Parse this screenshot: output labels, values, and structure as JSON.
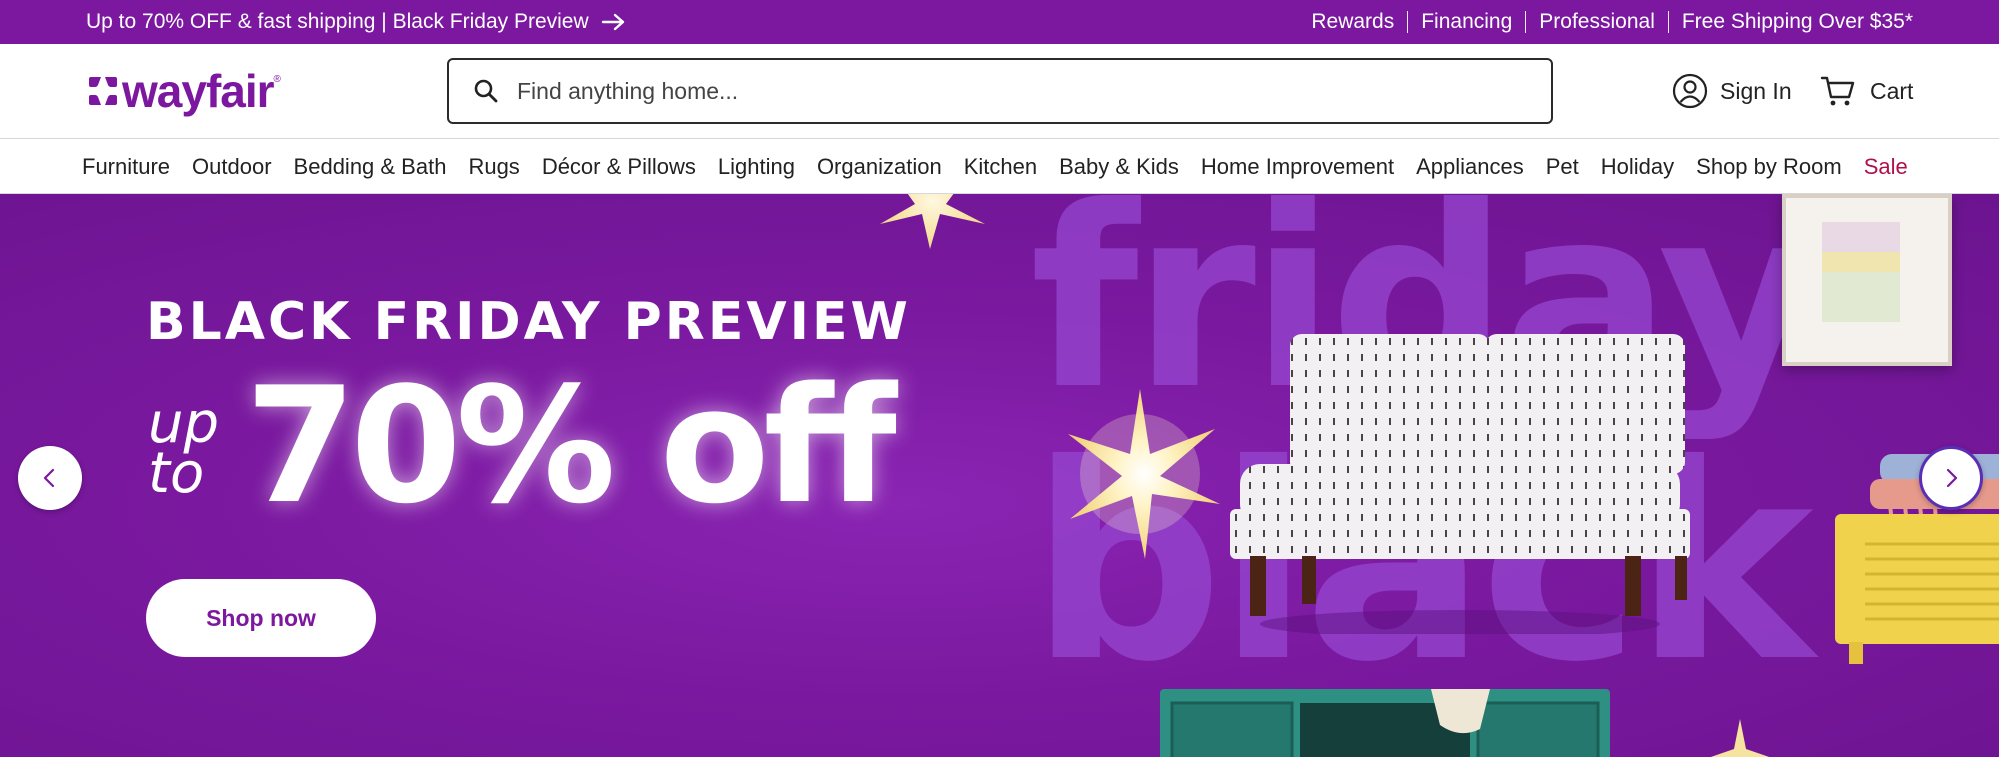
{
  "topbar": {
    "promo": "Up to 70% OFF & fast shipping | Black Friday Preview",
    "links": [
      "Rewards",
      "Financing",
      "Professional",
      "Free Shipping Over $35*"
    ]
  },
  "header": {
    "logo": "wayfair",
    "search_placeholder": "Find anything home...",
    "sign_in": "Sign In",
    "cart": "Cart"
  },
  "categories": [
    "Furniture",
    "Outdoor",
    "Bedding & Bath",
    "Rugs",
    "Décor & Pillows",
    "Lighting",
    "Organization",
    "Kitchen",
    "Baby & Kids",
    "Home Improvement",
    "Appliances",
    "Pet",
    "Holiday",
    "Shop by Room",
    "Sale"
  ],
  "hero": {
    "eyebrow": "BLACK FRIDAY PREVIEW",
    "up": "up",
    "to": "to",
    "big": "70% off",
    "cta": "Shop now",
    "bg_word_1": "friday",
    "bg_word_2": "black",
    "slides_total": 4,
    "slide_active": 1
  },
  "colors": {
    "brand": "#7b189f",
    "sale": "#b0104f"
  },
  "icons": {
    "search": "search-icon",
    "account": "account-circle-icon",
    "cart": "cart-icon",
    "prev": "chevron-left-icon",
    "next": "chevron-right-icon",
    "promo_arrow": "arrow-right-icon"
  }
}
